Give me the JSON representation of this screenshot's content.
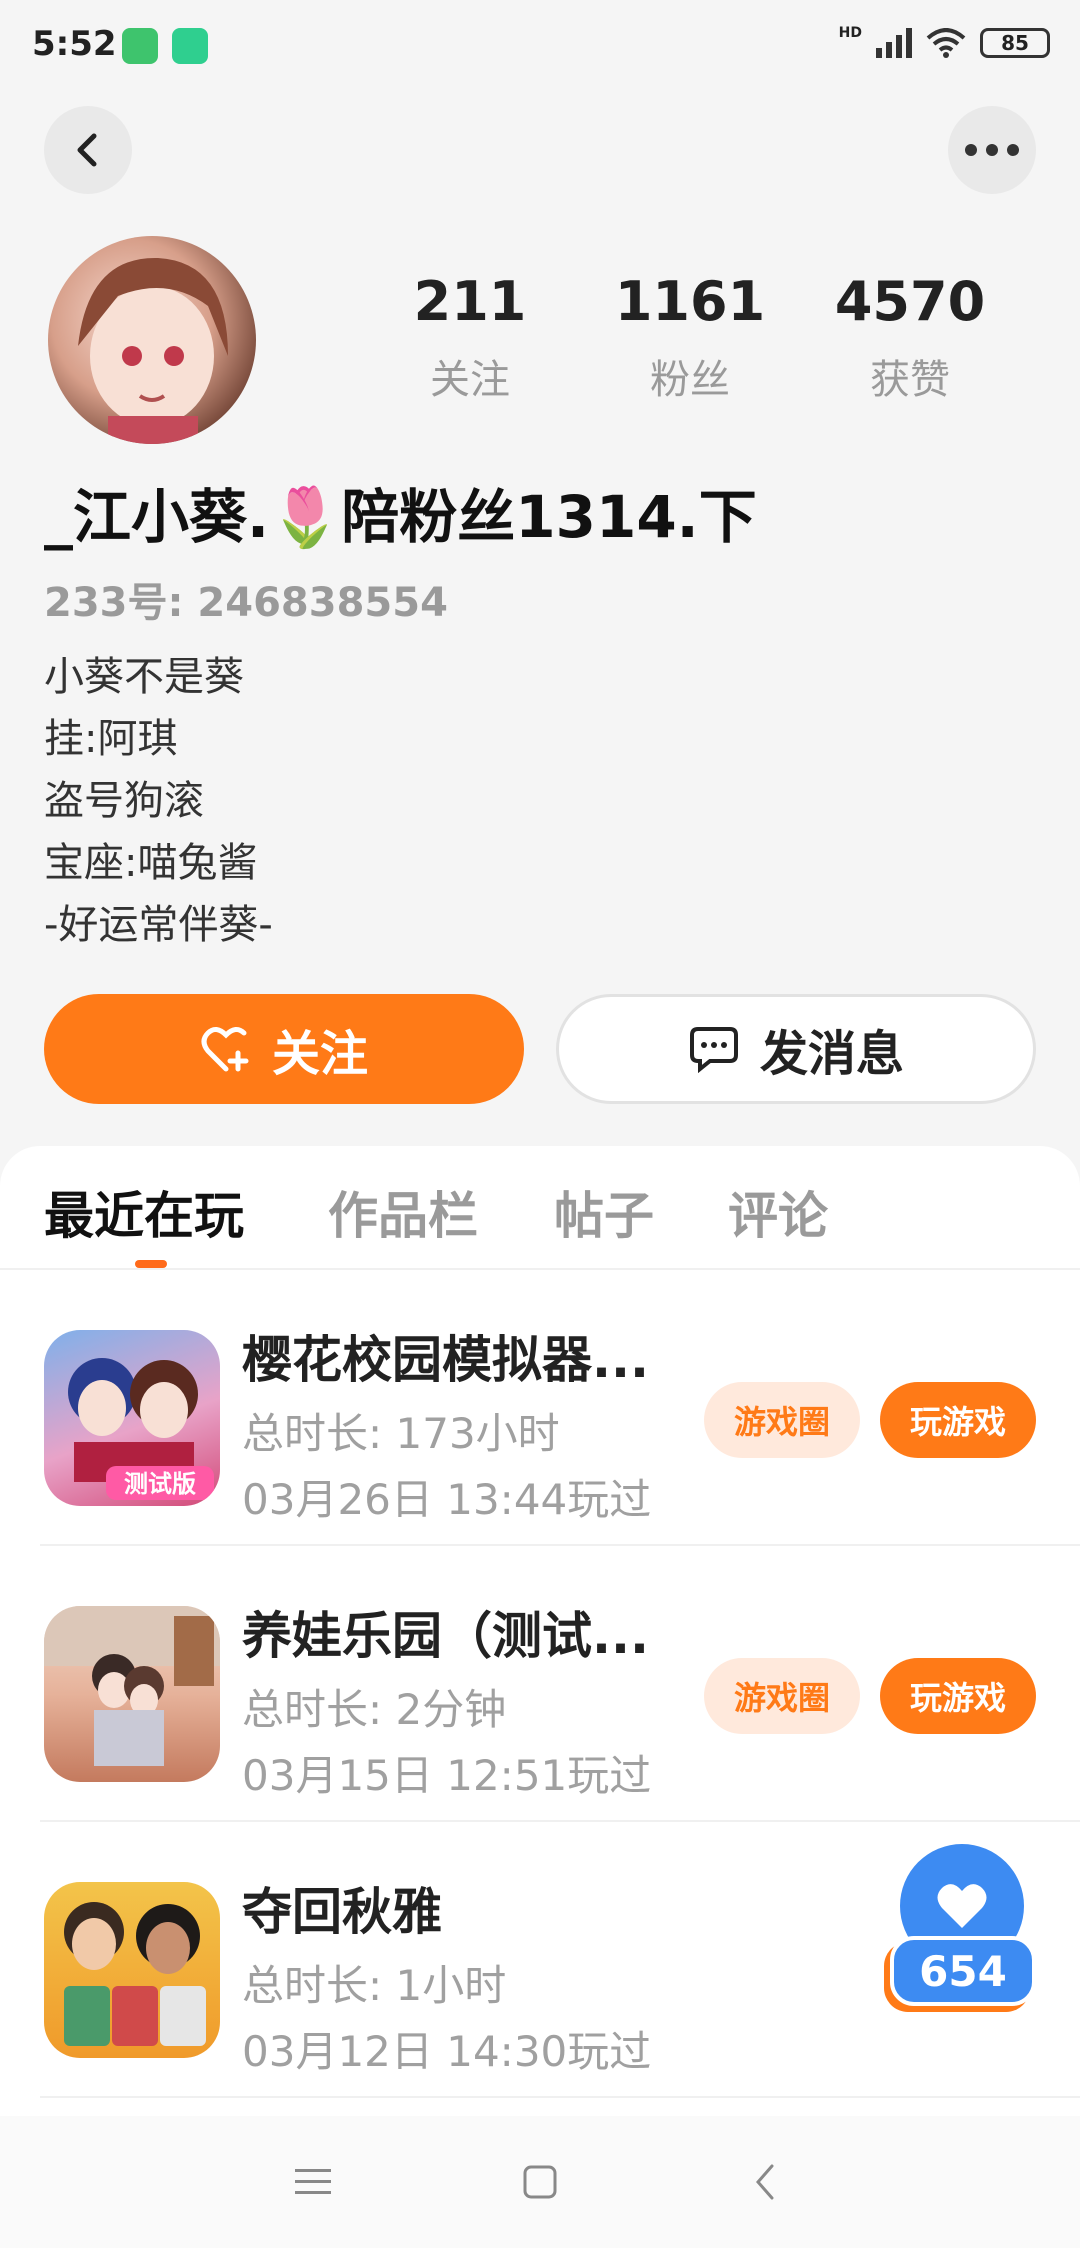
{
  "status_bar": {
    "time": "5:52",
    "network": "HD",
    "battery": "85"
  },
  "profile": {
    "stats": [
      {
        "value": "211",
        "label": "关注"
      },
      {
        "value": "1161",
        "label": "粉丝"
      },
      {
        "value": "4570",
        "label": "获赞"
      }
    ],
    "name": "_江小葵.🌷陪粉丝1314.下",
    "uid": "233号: 246838554",
    "bio": [
      "小葵不是葵",
      "挂:阿琪",
      "盗号狗滚",
      "宝座:喵兔酱",
      "-好运常伴葵-"
    ]
  },
  "actions": {
    "follow_label": "关注",
    "message_label": "发消息"
  },
  "tabs": [
    "最近在玩",
    "作品栏",
    "帖子",
    "评论"
  ],
  "games": [
    {
      "title": "樱花校园模拟器...",
      "duration": "总时长: 173小时",
      "last_played": "03月26日 13:44玩过",
      "circle_label": "游戏圈",
      "play_label": "玩游戏"
    },
    {
      "title": "养娃乐园（测试...",
      "duration": "总时长: 2分钟",
      "last_played": "03月15日 12:51玩过",
      "circle_label": "游戏圈",
      "play_label": "玩游戏"
    },
    {
      "title": "夺回秋雅",
      "duration": "总时长: 1小时",
      "last_played": "03月12日 14:30玩过"
    }
  ],
  "game_icon_texts": {
    "game1_badge": "测试版"
  },
  "floating_like": {
    "count": "654"
  },
  "colors": {
    "accent": "#ff7a17",
    "like_blue": "#3d8bf2"
  }
}
